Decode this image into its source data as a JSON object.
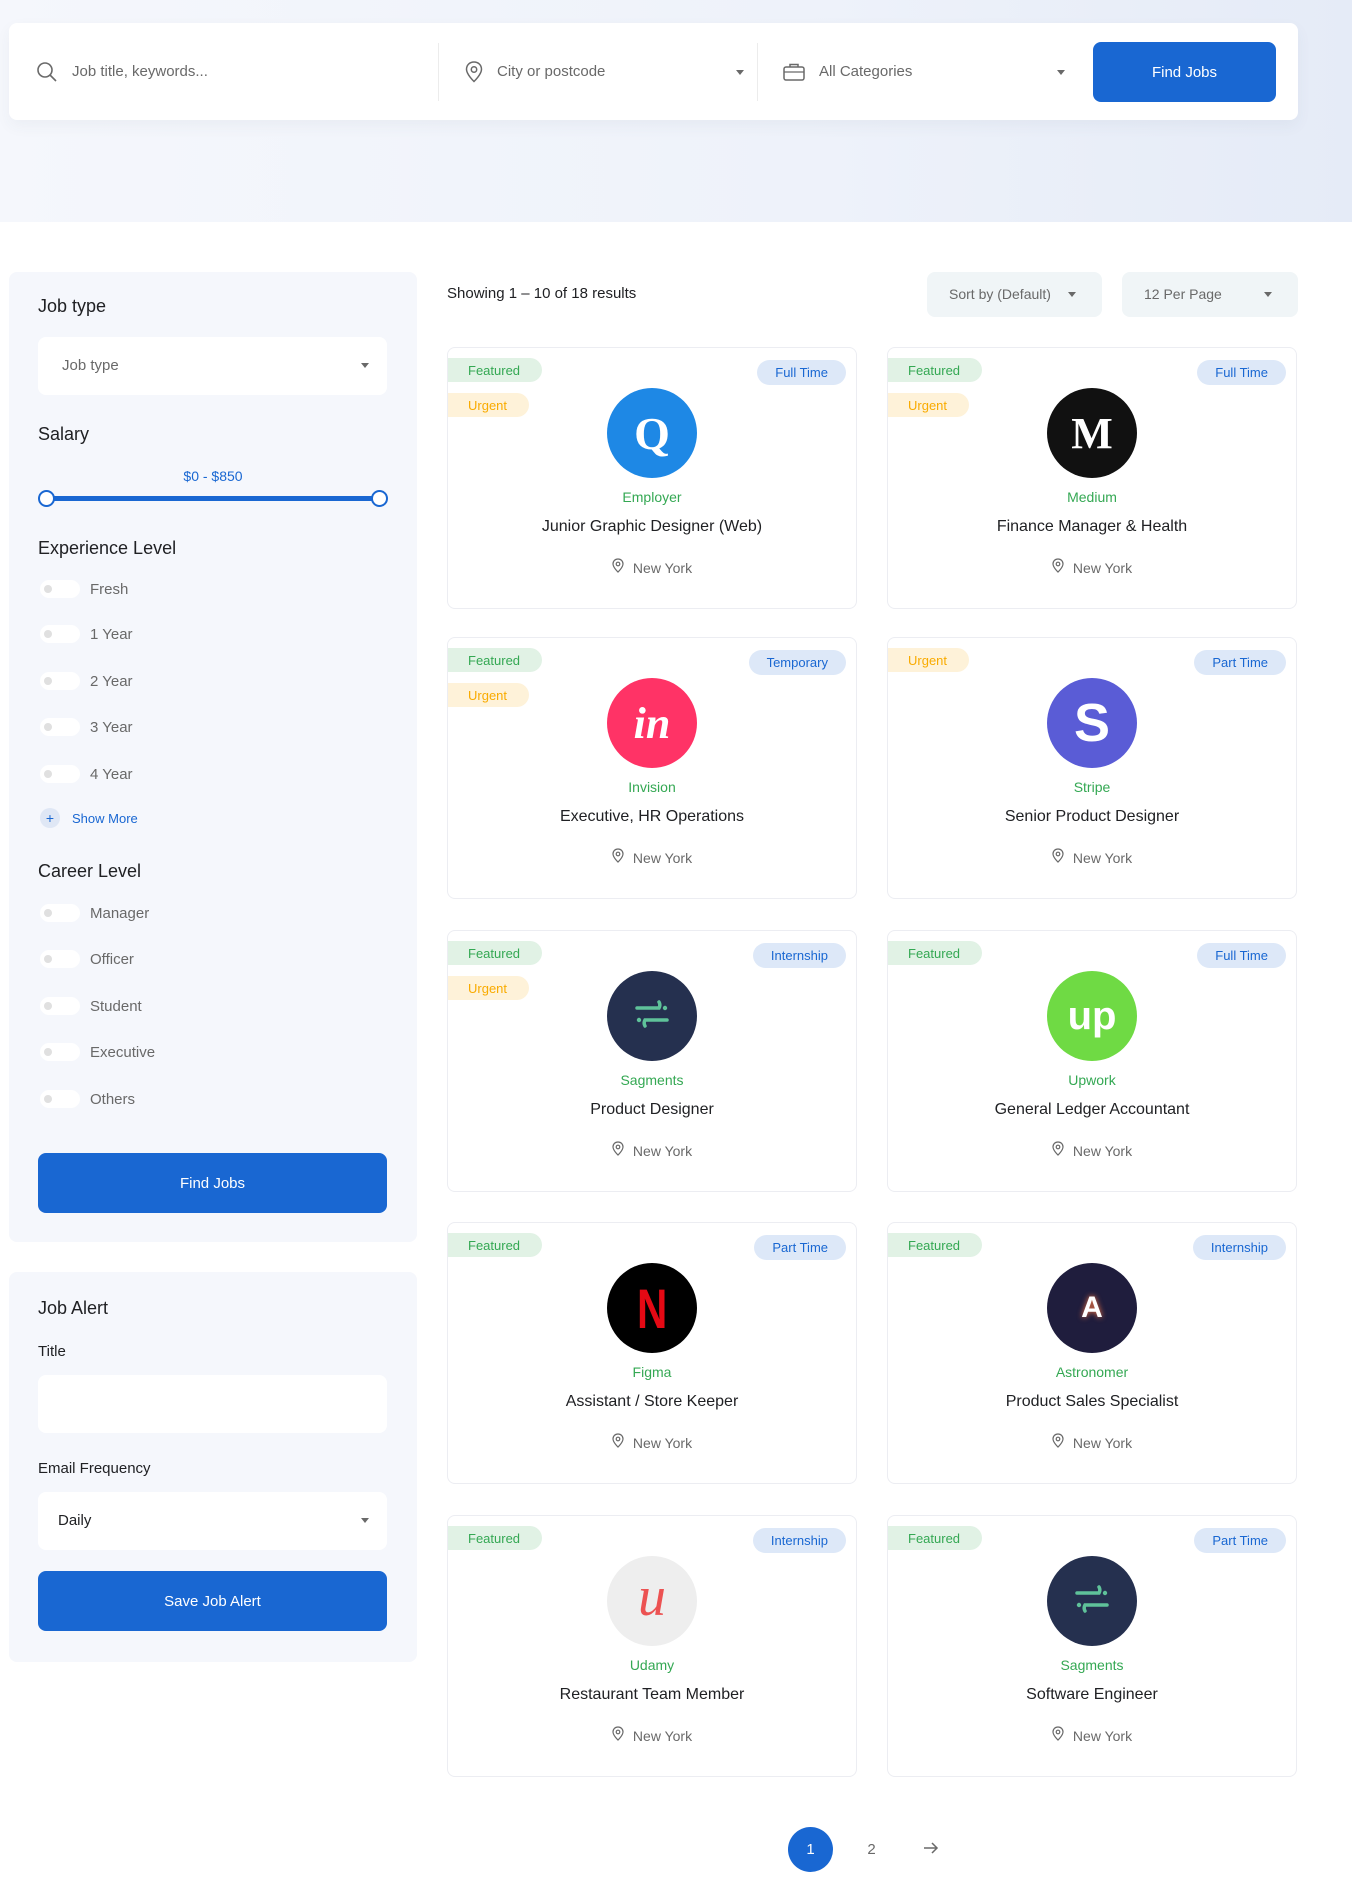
{
  "search": {
    "keywords_placeholder": "Job title, keywords...",
    "location_placeholder": "City or postcode",
    "category_value": "All Categories",
    "find_label": "Find Jobs"
  },
  "filters": {
    "job_type_title": "Job type",
    "job_type_value": "Job type",
    "salary_title": "Salary",
    "salary_range": "$0 - $850",
    "experience_title": "Experience Level",
    "experience_options": [
      "Fresh",
      "1 Year",
      "2 Year",
      "3 Year",
      "4 Year"
    ],
    "show_more": "Show More",
    "career_title": "Career Level",
    "career_options": [
      "Manager",
      "Officer",
      "Student",
      "Executive",
      "Others"
    ],
    "find_label": "Find Jobs"
  },
  "alert": {
    "title": "Job Alert",
    "title_label": "Title",
    "title_value": "",
    "frequency_label": "Email Frequency",
    "frequency_value": "Daily",
    "save_label": "Save Job Alert"
  },
  "results": {
    "showing": "Showing 1 – 10 of 18 results",
    "sort_value": "Sort by (Default)",
    "per_page_value": "12 Per Page"
  },
  "jobs": [
    {
      "company": "Employer",
      "title": "Junior Graphic Designer (Web)",
      "location": "New York",
      "type": "Full Time",
      "featured": "Featured",
      "urgent": "Urgent",
      "logo": "Q",
      "logo_color": "#1e88e5"
    },
    {
      "company": "Medium",
      "title": "Finance Manager & Health",
      "location": "New York",
      "type": "Full Time",
      "featured": "Featured",
      "urgent": "Urgent",
      "logo": "M",
      "logo_color": "#111111"
    },
    {
      "company": "Invision",
      "title": "Executive, HR Operations",
      "location": "New York",
      "type": "Temporary",
      "featured": "Featured",
      "urgent": "Urgent",
      "logo": "in",
      "logo_color": "#ff3366"
    },
    {
      "company": "Stripe",
      "title": "Senior Product Designer",
      "location": "New York",
      "type": "Part Time",
      "featured": "",
      "urgent": "Urgent",
      "logo": "S",
      "logo_color": "#5a5cd6"
    },
    {
      "company": "Sagments",
      "title": "Product Designer",
      "location": "New York",
      "type": "Internship",
      "featured": "Featured",
      "urgent": "Urgent",
      "logo": "segment-icon",
      "logo_color": "#25304f"
    },
    {
      "company": "Upwork",
      "title": "General Ledger Accountant",
      "location": "New York",
      "type": "Full Time",
      "featured": "Featured",
      "urgent": "",
      "logo": "up",
      "logo_color": "#6fda44"
    },
    {
      "company": "Figma",
      "title": "Assistant / Store Keeper",
      "location": "New York",
      "type": "Part Time",
      "featured": "Featured",
      "urgent": "",
      "logo": "N",
      "logo_color": "#000000"
    },
    {
      "company": "Astronomer",
      "title": "Product Sales Specialist",
      "location": "New York",
      "type": "Internship",
      "featured": "Featured",
      "urgent": "",
      "logo": "A",
      "logo_color": "#1f1d3d"
    },
    {
      "company": "Udamy",
      "title": "Restaurant Team Member",
      "location": "New York",
      "type": "Internship",
      "featured": "Featured",
      "urgent": "",
      "logo": "u",
      "logo_color": "#eeeeee"
    },
    {
      "company": "Sagments",
      "title": "Software Engineer",
      "location": "New York",
      "type": "Part Time",
      "featured": "Featured",
      "urgent": "",
      "logo": "segment-icon",
      "logo_color": "#25304f"
    }
  ],
  "pagination": {
    "pages": [
      "1",
      "2"
    ],
    "current": "1",
    "next_icon": "arrow-right-icon"
  },
  "colors": {
    "primary": "#1967d2",
    "green": "#34a853",
    "orange": "#f9ab00"
  }
}
